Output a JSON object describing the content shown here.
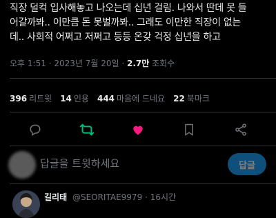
{
  "tweet": {
    "lines": [
      "직장 덜컥 입사해놓고 나오는데 십년 걸림. 나와서 딴데 못 들",
      "어갈까봐.. 이만큼 돈 못벌까봐.. 그래도 이만한 직장이 없는",
      "데.. 사회적 어쩌고 저쩌고 등등 온갖 걱정 십년을 하고"
    ],
    "time": "오후 1:51",
    "date": "2023년 7월 20일",
    "views_count": "2.7만",
    "views_label": "조회수"
  },
  "stats": {
    "retweets": {
      "count": "396",
      "label": "리트윗"
    },
    "quotes": {
      "count": "14",
      "label": "인용"
    },
    "likes": {
      "count": "444",
      "label": "마음에 드네요"
    },
    "bookmarks": {
      "count": "22",
      "label": "북마크"
    }
  },
  "actions": [
    "reply-icon",
    "retweet-icon",
    "like-icon",
    "bookmark-icon",
    "share-icon"
  ],
  "colors": {
    "retweet": "#00ba7c",
    "like": "#f91880",
    "icon": "#71767b",
    "reply_button": "#0e4f7c"
  },
  "reply": {
    "placeholder": "답글을 트윗하세요",
    "button_label": "답글"
  },
  "next_tweet": {
    "name": "길리태",
    "handle": "@SEORITAE9979",
    "separator": "·",
    "time_ago": "16시간"
  }
}
